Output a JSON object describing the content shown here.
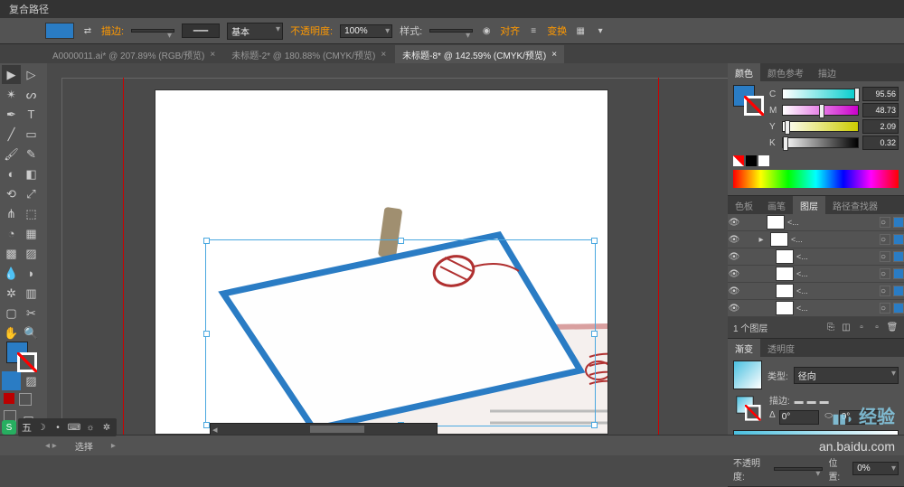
{
  "menubar": {
    "pathinfo": "复合路径"
  },
  "optbar": {
    "fill_label": "填色:",
    "stroke_label": "描边:",
    "stroke_weight": "",
    "style_basic": "基本",
    "opacity_label": "不透明度:",
    "opacity_value": "100%",
    "styledrop_label": "样式:",
    "align_btn": "对齐",
    "transform_btn": "变换"
  },
  "tabs": [
    {
      "label": "A0000011.ai* @ 207.89% (RGB/预览)",
      "active": false
    },
    {
      "label": "未标题-2* @ 180.88% (CMYK/预览)",
      "active": false
    },
    {
      "label": "未标题-8* @ 142.59% (CMYK/预览)",
      "active": true
    }
  ],
  "color_panel": {
    "tab1": "颜色",
    "tab2": "颜色参考",
    "tab3": "描边",
    "channels": [
      {
        "lbl": "C",
        "val": "95.56",
        "cls": "c",
        "pos": 95
      },
      {
        "lbl": "M",
        "val": "48.73",
        "cls": "m",
        "pos": 48
      },
      {
        "lbl": "Y",
        "val": "2.09",
        "cls": "y",
        "pos": 2
      },
      {
        "lbl": "K",
        "val": "0.32",
        "cls": "k",
        "pos": 0
      }
    ]
  },
  "layers_panel": {
    "tab1": "色板",
    "tab2": "画笔",
    "tab3": "图层",
    "tab4": "路径查找器",
    "rows": [
      {
        "name": "<...",
        "indent": 1
      },
      {
        "name": "<...",
        "indent": 1,
        "expand": true
      },
      {
        "name": "<...",
        "indent": 2
      },
      {
        "name": "<...",
        "indent": 2
      },
      {
        "name": "<...",
        "indent": 2
      },
      {
        "name": "<...",
        "indent": 2
      }
    ],
    "footer": "1 个图层"
  },
  "grad_panel": {
    "tab1": "渐变",
    "tab2": "透明度",
    "type_label": "类型:",
    "type_value": "径向",
    "stroke_label": "描边:",
    "angle_label": "Δ",
    "angle_value": "0°",
    "ratio_value": "0°",
    "opacity_label": "不透明度:",
    "pos_label": "位置:",
    "pos_value": "0%"
  },
  "statusbar": {
    "tool": "选择"
  },
  "watermark": {
    "brand": "经验",
    "domain": "an.baidu.com"
  },
  "ime": {
    "label": "五"
  }
}
